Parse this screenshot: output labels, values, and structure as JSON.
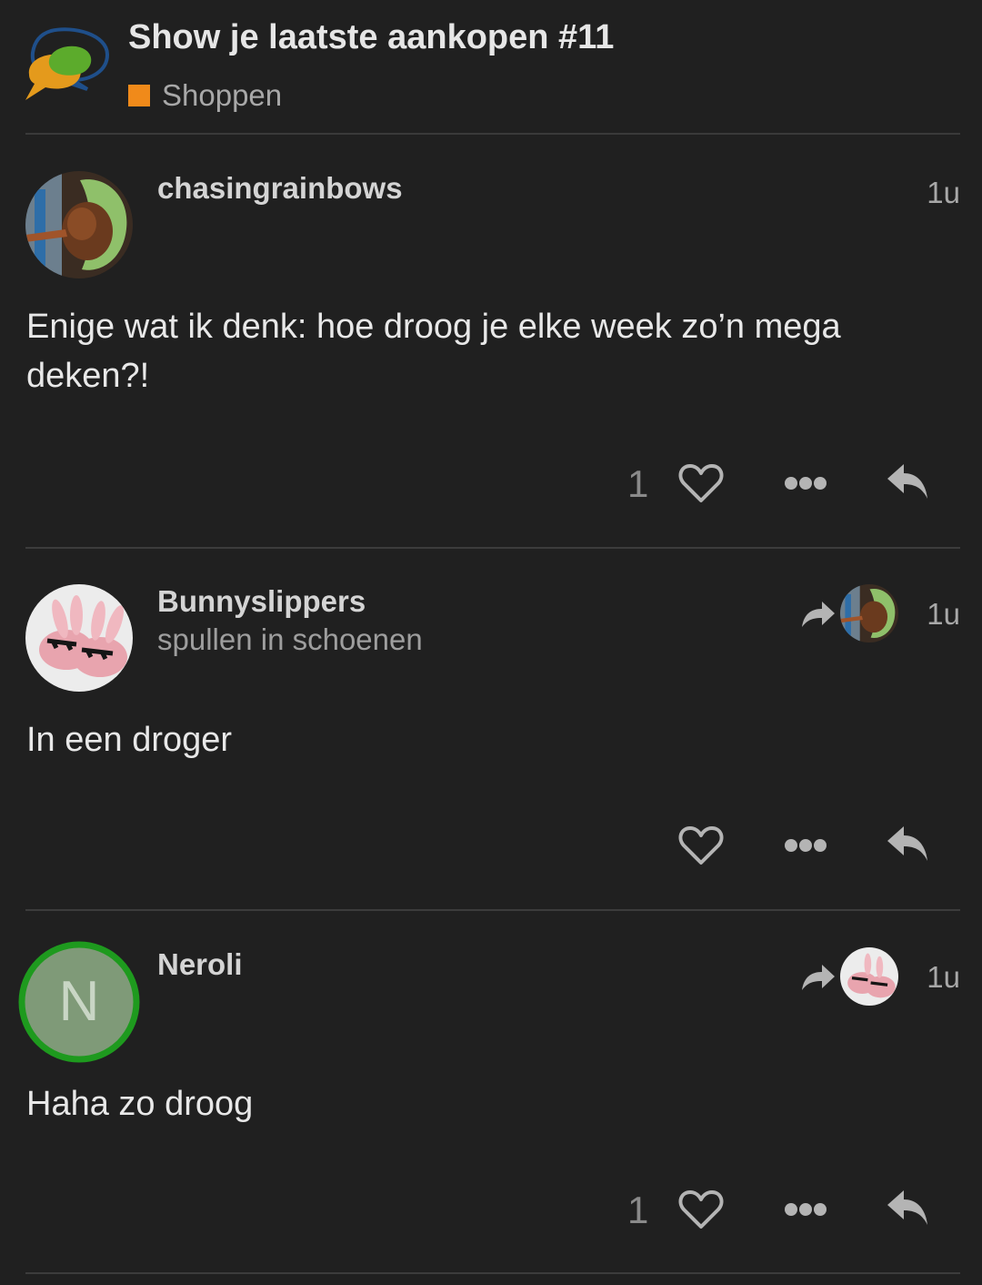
{
  "topic": {
    "title": "Show je laatste aankopen #11",
    "category": "Shoppen",
    "category_color": "#f08a1a"
  },
  "posts": [
    {
      "username": "chasingrainbows",
      "user_title": "",
      "time": "1u",
      "body": "Enige wat ik denk: hoe droog je elke week zo’n mega deken?!",
      "like_count": "1",
      "reply_to": null
    },
    {
      "username": "Bunnyslippers",
      "user_title": "spullen in schoenen",
      "time": "1u",
      "body": "In een droger",
      "like_count": "",
      "reply_to": "chasingrainbows"
    },
    {
      "username": "Neroli",
      "user_title": "",
      "avatar_letter": "N",
      "time": "1u",
      "body": "Haha zo droog",
      "like_count": "1",
      "reply_to": "Bunnyslippers"
    }
  ],
  "icons": {
    "like": "heart-icon",
    "more": "ellipsis-icon",
    "reply": "reply-icon",
    "reply_to": "share-arrow-icon"
  },
  "colors": {
    "background": "#202020",
    "online_ring": "#1e9a1e",
    "letter_avatar": "#7f9a78"
  }
}
